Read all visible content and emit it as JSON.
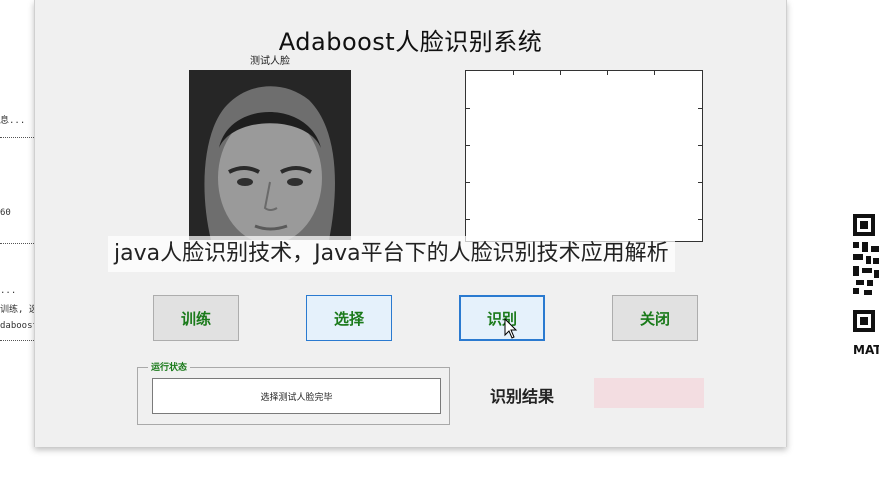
{
  "console": {
    "lines": [
      "息...",
      "60",
      "...",
      "训练, 选",
      "daboost识"
    ]
  },
  "window": {
    "title": "Adaboost人脸识别系统",
    "face_label": "测试人脸"
  },
  "buttons": {
    "train": "训练",
    "select": "选择",
    "recognize": "识别",
    "close": "关闭"
  },
  "status_panel": {
    "title": "运行状态",
    "message": "选择测试人脸完毕"
  },
  "result": {
    "label": "识别结果",
    "value": ""
  },
  "watermark": "java人脸识别技术，Java平台下的人脸识别技术应用解析",
  "qr_caption": "MAT",
  "colors": {
    "button_text": "#1a7a1a",
    "result_box": "#f3dde1",
    "selected_border": "#2a7ad0"
  }
}
